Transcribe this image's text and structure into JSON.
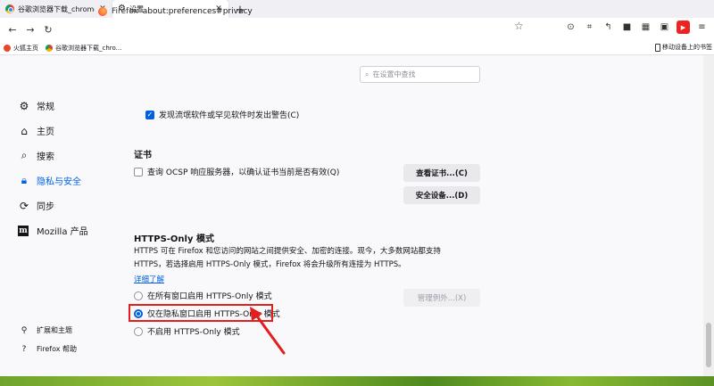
{
  "tabs": [
    {
      "title": "谷歌浏览器下载_chrome浏览器",
      "icon": "chrome-icon",
      "active": false
    },
    {
      "title": "设置",
      "icon": "gear-icon",
      "active": true
    }
  ],
  "navbar": {
    "identity": "Firefox",
    "url": "about:preferences#privacy"
  },
  "bookmarks": {
    "items": [
      "火狐主页",
      "谷歌浏览器下载_chro..."
    ],
    "mobile": "移动设备上的书签"
  },
  "search": {
    "placeholder": "在设置中查找"
  },
  "sidebar": {
    "items": [
      {
        "label": "常规",
        "icon": "gear-icon"
      },
      {
        "label": "主页",
        "icon": "home-icon"
      },
      {
        "label": "搜索",
        "icon": "search-icon"
      },
      {
        "label": "隐私与安全",
        "icon": "lock-icon",
        "selected": true
      },
      {
        "label": "同步",
        "icon": "sync-icon"
      },
      {
        "label": "Mozilla 产品",
        "icon": "mozilla-icon"
      }
    ],
    "footer": [
      {
        "label": "扩展和主题",
        "icon": "puzzle-icon"
      },
      {
        "label": "Firefox 帮助",
        "icon": "help-icon"
      }
    ]
  },
  "security": {
    "warn_label": "发现流氓软件或罕见软件时发出警告(C)",
    "warn_checked": true
  },
  "certificates": {
    "heading": "证书",
    "ocsp_label": "查询 OCSP 响应服务器，以确认证书当前是否有效(Q)",
    "ocsp_checked": false,
    "view_button": "查看证书...(C)",
    "devices_button": "安全设备...(D)"
  },
  "https_only": {
    "heading": "HTTPS-Only 模式",
    "description_line1": "HTTPS 可在 Firefox 和您访问的网站之间提供安全、加密的连接。现今，大多数网站都支持",
    "description_line2": "HTTPS，若选择启用 HTTPS-Only 模式，Firefox 将会升级所有连接为 HTTPS。",
    "learn_more": "详细了解",
    "options": [
      {
        "label": "在所有窗口启用 HTTPS-Only 模式",
        "checked": false
      },
      {
        "label": "仅在隐私窗口启用 HTTPS-Only 模式",
        "checked": true
      },
      {
        "label": "不启用 HTTPS-Only 模式",
        "checked": false
      }
    ],
    "manage_exceptions": "管理例外...(X)"
  },
  "colors": {
    "accent": "#0061e0",
    "annotation": "#e21e1e"
  }
}
